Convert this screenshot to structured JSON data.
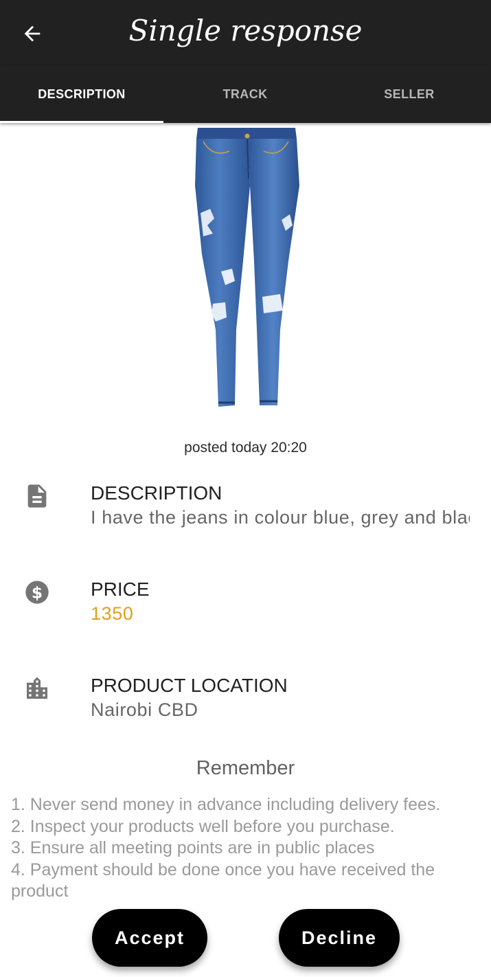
{
  "header": {
    "title": "Single response",
    "back_icon": "arrow-left-icon"
  },
  "tabs": [
    {
      "label": "DESCRIPTION",
      "active": true
    },
    {
      "label": "TRACK",
      "active": false
    },
    {
      "label": "SELLER",
      "active": false
    }
  ],
  "product": {
    "image": "blue-ripped-jeans-photo",
    "posted": "posted today 20:20"
  },
  "details": [
    {
      "icon": "document-icon",
      "label": "DESCRIPTION",
      "value": "I have the jeans in colour blue, grey and black"
    },
    {
      "icon": "dollar-circle-icon",
      "label": "PRICE",
      "value": "1350"
    },
    {
      "icon": "city-buildings-icon",
      "label": "PRODUCT LOCATION",
      "value": "Nairobi CBD"
    }
  ],
  "remember": {
    "title": "Remember",
    "tips": [
      "1. Never send money in advance including delivery fees.",
      "2. Inspect your products well before you purchase.",
      "3. Ensure all meeting points are in public places",
      "4. Payment should be done once you have received the product"
    ]
  },
  "actions": {
    "accept_label": "Accept",
    "decline_label": "Decline"
  },
  "colors": {
    "topbar": "#212121",
    "price": "#e0a019",
    "button": "#000000"
  }
}
